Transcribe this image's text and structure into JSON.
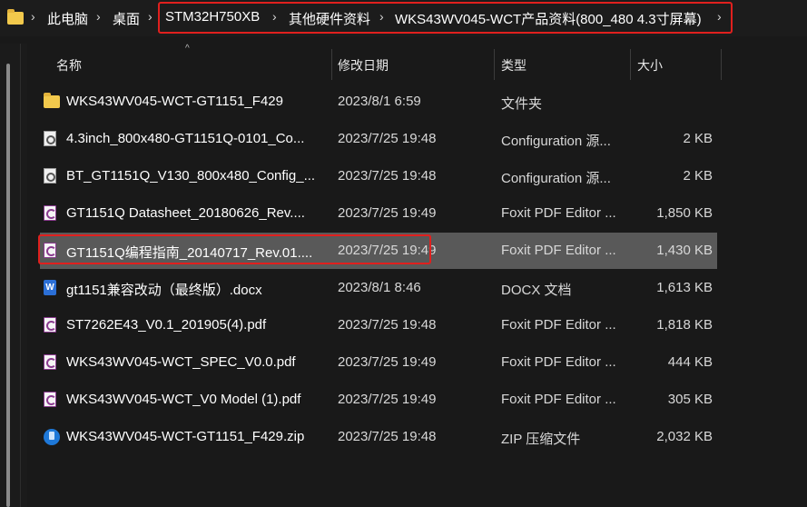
{
  "address_bar": {
    "segments": [
      "此电脑",
      "桌面",
      "STM32H750XB",
      "其他硬件资料",
      "WKS43WV045-WCT产品资料(800_480 4.3寸屏幕)"
    ],
    "separator": "›",
    "highlight_color": "#e0201e"
  },
  "columns": {
    "name": "名称",
    "date": "修改日期",
    "type": "类型",
    "size": "大小"
  },
  "sort_indicator": "^",
  "files": [
    {
      "icon": "folder-icon",
      "name": "WKS43WV045-WCT-GT1151_F429",
      "date": "2023/8/1 6:59",
      "type": "文件夹",
      "size": ""
    },
    {
      "icon": "config-file-icon",
      "name": "4.3inch_800x480-GT1151Q-0101_Co...",
      "date": "2023/7/25 19:48",
      "type": "Configuration 源...",
      "size": "2 KB"
    },
    {
      "icon": "config-file-icon",
      "name": "BT_GT1151Q_V130_800x480_Config_...",
      "date": "2023/7/25 19:48",
      "type": "Configuration 源...",
      "size": "2 KB"
    },
    {
      "icon": "pdf-icon",
      "name": "GT1151Q Datasheet_20180626_Rev....",
      "date": "2023/7/25 19:49",
      "type": "Foxit PDF Editor ...",
      "size": "1,850 KB"
    },
    {
      "icon": "pdf-icon",
      "name": "GT1151Q编程指南_20140717_Rev.01....",
      "date": "2023/7/25 19:49",
      "type": "Foxit PDF Editor ...",
      "size": "1,430 KB",
      "selected": true
    },
    {
      "icon": "word-doc-icon",
      "name": "gt1151兼容改动（最终版）.docx",
      "date": "2023/8/1 8:46",
      "type": "DOCX 文档",
      "size": "1,613 KB"
    },
    {
      "icon": "pdf-icon",
      "name": "ST7262E43_V0.1_201905(4).pdf",
      "date": "2023/7/25 19:48",
      "type": "Foxit PDF Editor ...",
      "size": "1,818 KB"
    },
    {
      "icon": "pdf-icon",
      "name": "WKS43WV045-WCT_SPEC_V0.0.pdf",
      "date": "2023/7/25 19:49",
      "type": "Foxit PDF Editor ...",
      "size": "444 KB"
    },
    {
      "icon": "pdf-icon",
      "name": "WKS43WV045-WCT_V0 Model (1).pdf",
      "date": "2023/7/25 19:49",
      "type": "Foxit PDF Editor ...",
      "size": "305 KB"
    },
    {
      "icon": "zip-icon",
      "name": "WKS43WV045-WCT-GT1151_F429.zip",
      "date": "2023/7/25 19:48",
      "type": "ZIP 压缩文件",
      "size": "2,032 KB"
    }
  ]
}
